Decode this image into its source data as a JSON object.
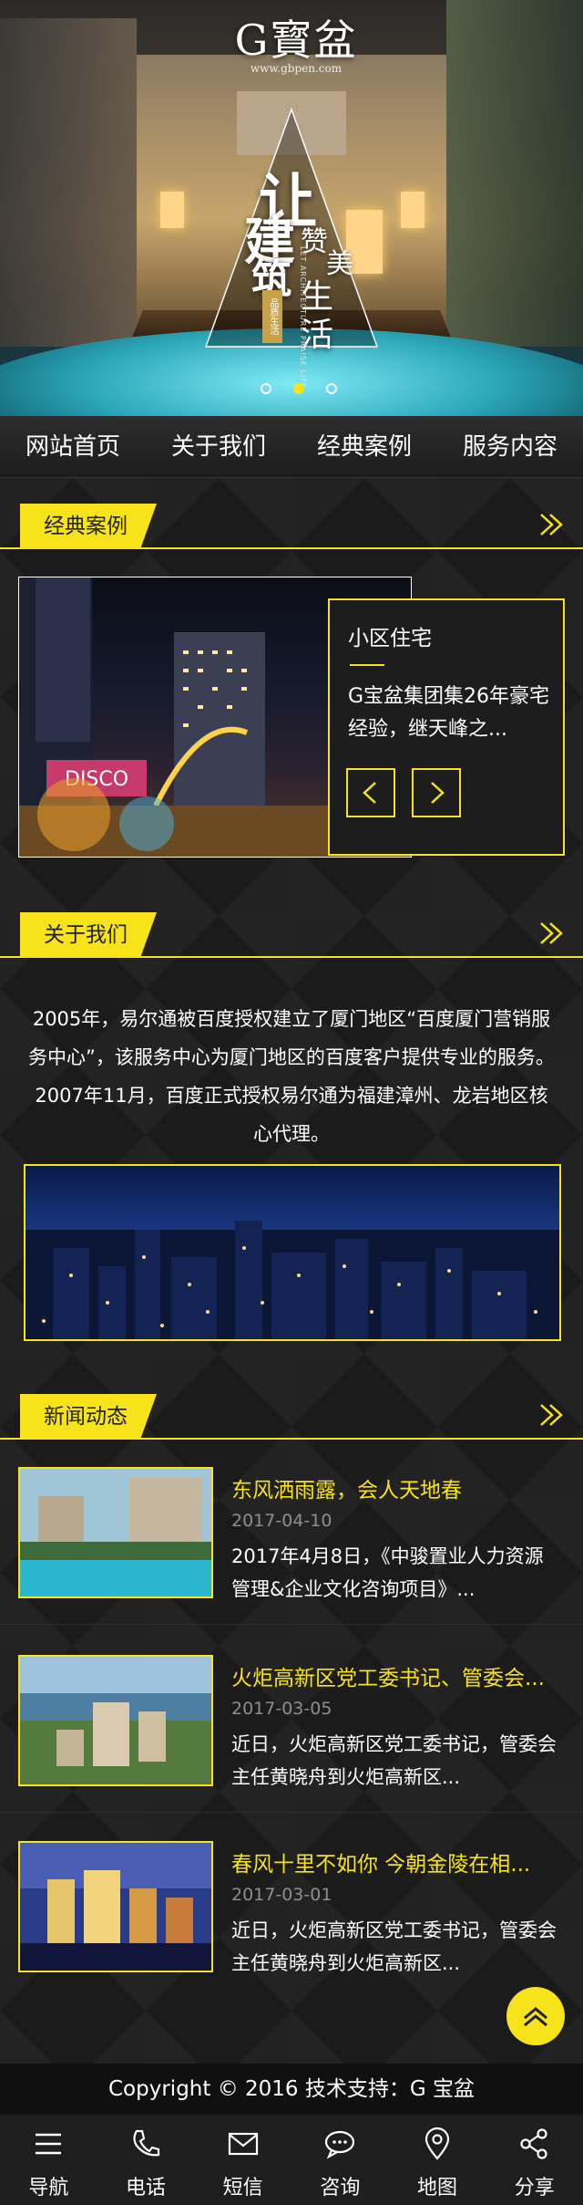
{
  "header": {
    "logo_text": "G寳盆",
    "logo_url": "www.gbpen.com",
    "slogan_big_1": "让",
    "slogan_big_2": "建",
    "slogan_big_3": "筑",
    "slogan_right_1": "赞",
    "slogan_right_2": "美",
    "slogan_right_3": "生",
    "slogan_right_4": "活",
    "slogan_stamp": "品质生活",
    "slogan_en": "LET ARCHITECTURE PRAISE LIFE",
    "slide_count": 3,
    "active_slide": 2
  },
  "nav": {
    "items": [
      {
        "label": "网站首页"
      },
      {
        "label": "关于我们"
      },
      {
        "label": "经典案例"
      },
      {
        "label": "服务内容"
      }
    ]
  },
  "cases": {
    "section_title": "经典案例",
    "title": "小区住宅",
    "desc": "G宝盆集团集26年豪宅经验，继天峰之..."
  },
  "about": {
    "section_title": "关于我们",
    "text": "2005年，易尔通被百度授权建立了厦门地区“百度厦门营销服务中心”，该服务中心为厦门地区的百度客户提供专业的服务。2007年11月，百度正式授权易尔通为福建漳州、龙岩地区核心代理。"
  },
  "news": {
    "section_title": "新闻动态",
    "items": [
      {
        "title": "东风洒雨露，会人天地春",
        "date": "2017-04-10",
        "desc": "2017年4月8日，《中骏置业人力资源管理&企业文化咨询项目》..."
      },
      {
        "title": "火炬高新区党工委书记、管委会...",
        "date": "2017-03-05",
        "desc": "近日，火炬高新区党工委书记，管委会主任黄晓舟到火炬高新区..."
      },
      {
        "title": "春风十里不如你 今朝金陵在相...",
        "date": "2017-03-01",
        "desc": "近日，火炬高新区党工委书记，管委会主任黄晓舟到火炬高新区..."
      }
    ]
  },
  "footer": {
    "copyright": "Copyright © 2016  技术支持：G 宝盆",
    "bottom_bar": [
      {
        "label": "导航",
        "icon": "menu-icon"
      },
      {
        "label": "电话",
        "icon": "phone-icon"
      },
      {
        "label": "短信",
        "icon": "mail-icon"
      },
      {
        "label": "咨询",
        "icon": "chat-icon"
      },
      {
        "label": "地图",
        "icon": "map-pin-icon"
      },
      {
        "label": "分享",
        "icon": "share-icon"
      }
    ]
  },
  "colors": {
    "accent": "#f6e31a",
    "background": "#1b1b1b"
  }
}
